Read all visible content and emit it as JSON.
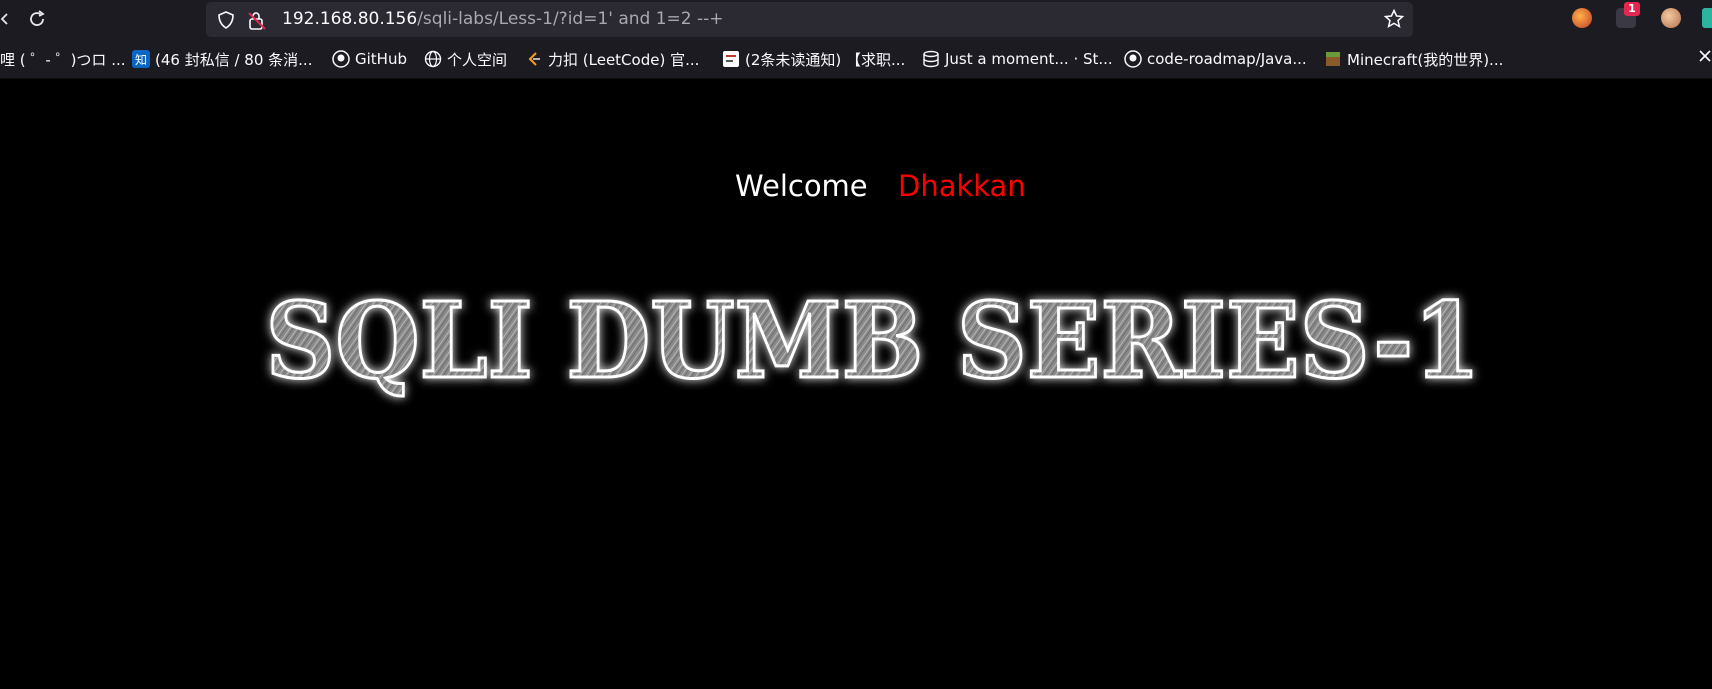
{
  "browser": {
    "url_host": "192.168.80.156",
    "url_path": "/sqli-labs/Less-1/?id=1' and 1=2 --+",
    "nav": {
      "back_icon": "back-icon",
      "reload_icon": "reload-icon"
    },
    "extensions": {
      "badge_count": "1"
    }
  },
  "bookmarks": [
    {
      "label": "哩 ( ゜- ゜)つロ ...",
      "icon": "bilibili-icon"
    },
    {
      "label": "(46 封私信 / 80 条消...",
      "icon": "zhihu-icon"
    },
    {
      "label": "GitHub",
      "icon": "github-icon"
    },
    {
      "label": "个人空间",
      "icon": "globe-icon"
    },
    {
      "label": "力扣 (LeetCode) 官...",
      "icon": "leetcode-icon"
    },
    {
      "label": "(2条未读通知) 【求职...",
      "icon": "note-icon"
    },
    {
      "label": "Just a moment... · St...",
      "icon": "stack-icon"
    },
    {
      "label": "code-roadmap/Java...",
      "icon": "github-icon"
    },
    {
      "label": "Minecraft(我的世界)...",
      "icon": "minecraft-icon"
    }
  ],
  "page": {
    "welcome_label": "Welcome",
    "welcome_name": "Dhakkan",
    "banner_text": "SQLI DUMB SERIES-1"
  },
  "colors": {
    "toolbar_bg": "#1c1b22",
    "urlbar_bg": "#2b2a33",
    "page_bg": "#000000",
    "name_color": "#ff0000"
  }
}
